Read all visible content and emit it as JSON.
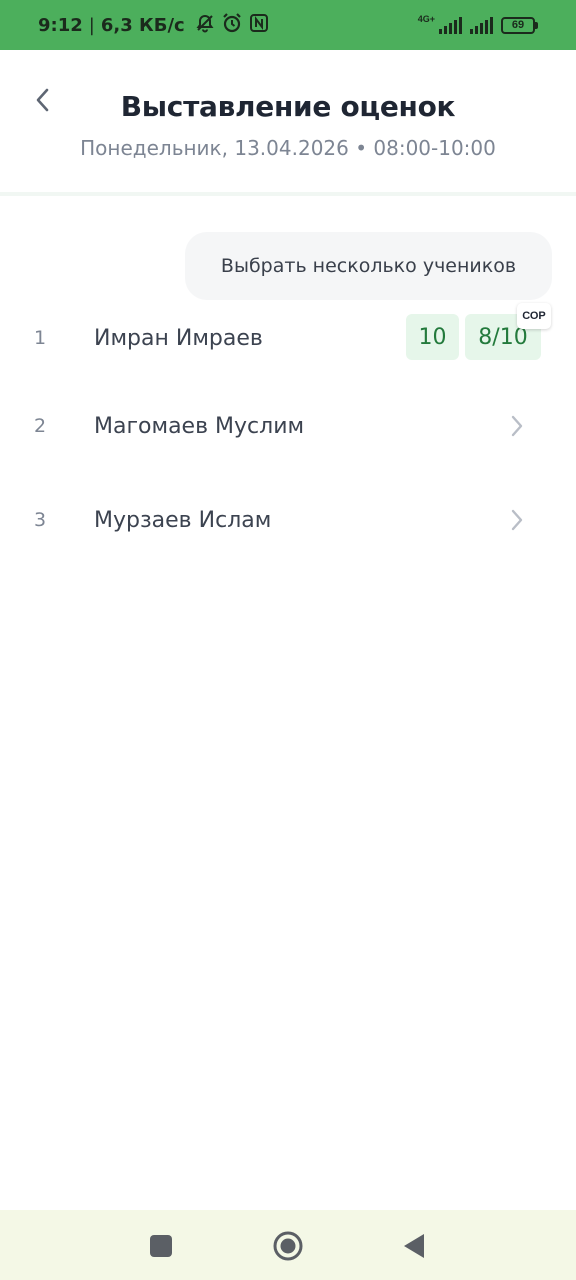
{
  "status_bar": {
    "time": "9:12",
    "separator": "|",
    "speed": "6,3 КБ/с",
    "network_label": "4G+",
    "battery": "69",
    "icons": [
      "mute-notifications-icon",
      "alarm-icon",
      "nfc-icon",
      "signal-icon",
      "signal-icon",
      "battery-icon"
    ]
  },
  "header": {
    "back_icon": "chevron-left-icon",
    "title": "Выставление оценок",
    "lesson_info": "Понедельник, 13.04.2026 • 08:00-10:00"
  },
  "select_multiple_label": "Выбрать несколько учеников",
  "students": [
    {
      "num": "1",
      "name": "Имран Имраев",
      "grades": [
        "10",
        "8/10"
      ],
      "badge": "СОР"
    },
    {
      "num": "2",
      "name": "Магомаев Муслим",
      "action_icon": "chevron-right-icon"
    },
    {
      "num": "3",
      "name": "Мурзаев Ислам",
      "action_icon": "chevron-right-icon"
    }
  ],
  "nav_bar": {
    "icons": [
      "recents-square-icon",
      "home-circle-icon",
      "back-triangle-icon"
    ]
  },
  "colors": {
    "status_bar": "#4caf5c",
    "grade_bg": "#e6f6ea",
    "grade_text": "#237a3c",
    "nav_bar": "#f4f8e6"
  }
}
